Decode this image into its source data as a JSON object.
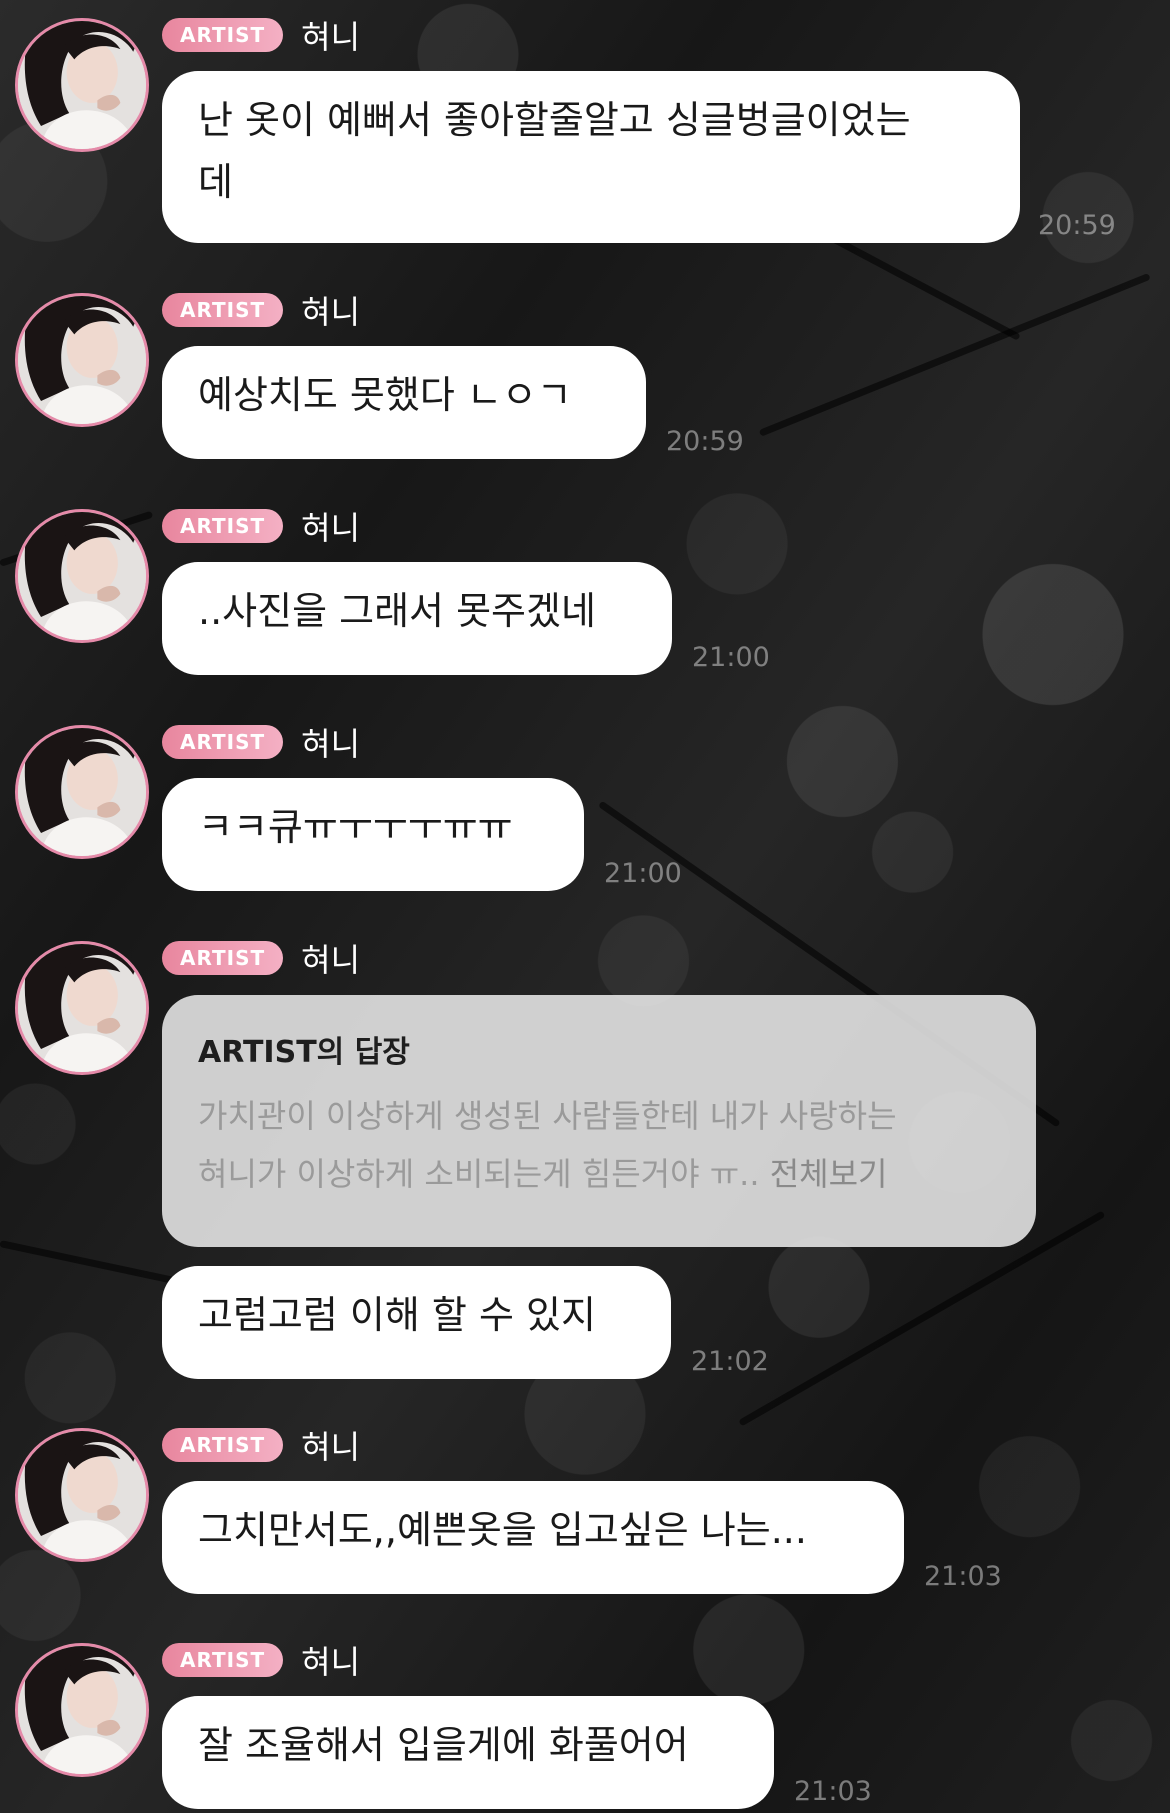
{
  "sender": {
    "badge": "ARTIST",
    "name": "혀니"
  },
  "messages": [
    {
      "text": "난 옷이 예뻐서 좋아할줄알고 싱글벙글이었는\n데",
      "time": "20:59"
    },
    {
      "text": "예상치도 못했다 ㄴㅇㄱ",
      "time": "20:59"
    },
    {
      "text": "..사진을 그래서 못주겠네",
      "time": "21:00"
    },
    {
      "text": "ㅋㅋ큐ㅠㅜㅜㅜㅠㅠ",
      "time": "21:00"
    },
    {
      "reply_title": "ARTIST의 답장",
      "reply_text": "가치관이 이상하게 생성된 사람들한테 내가 사랑하는\n혀니가 이상하게 소비되는게 힘든거야 ㅠ..",
      "reply_more": "전체보기"
    },
    {
      "text": "고럼고럼 이해 할 수 있지",
      "time": "21:02"
    },
    {
      "text": "그치만서도,,예쁜옷을 입고싶은 나는...",
      "time": "21:03"
    },
    {
      "text": "잘 조율해서 입을게에 화풀어어",
      "time": "21:03"
    }
  ],
  "colors": {
    "badge_gradient_start": "#e8869e",
    "badge_gradient_end": "#f4b0c4",
    "avatar_ring": "#e58aa9",
    "bubble": "#ffffff",
    "background": "#1e1e1e"
  }
}
